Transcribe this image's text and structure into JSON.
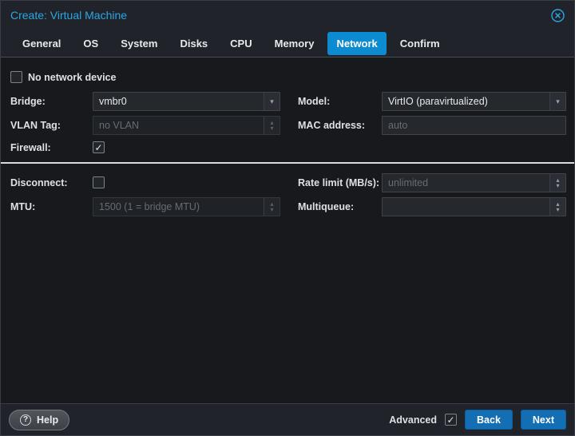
{
  "window": {
    "title": "Create: Virtual Machine"
  },
  "tabs": [
    {
      "label": "General",
      "active": false
    },
    {
      "label": "OS",
      "active": false
    },
    {
      "label": "System",
      "active": false
    },
    {
      "label": "Disks",
      "active": false
    },
    {
      "label": "CPU",
      "active": false
    },
    {
      "label": "Memory",
      "active": false
    },
    {
      "label": "Network",
      "active": true
    },
    {
      "label": "Confirm",
      "active": false
    }
  ],
  "form": {
    "no_network_device": {
      "label": "No network device",
      "checked": false
    },
    "bridge": {
      "label": "Bridge:",
      "value": "vmbr0",
      "type": "combo"
    },
    "vlan": {
      "label": "VLAN Tag:",
      "placeholder": "no VLAN",
      "type": "number",
      "disabled": true
    },
    "firewall": {
      "label": "Firewall:",
      "checked": true
    },
    "model": {
      "label": "Model:",
      "value": "VirtIO (paravirtualized)",
      "type": "combo"
    },
    "mac": {
      "label": "MAC address:",
      "placeholder": "auto",
      "type": "text"
    },
    "disconnect": {
      "label": "Disconnect:",
      "checked": false
    },
    "mtu": {
      "label": "MTU:",
      "placeholder": "1500 (1 = bridge MTU)",
      "type": "number",
      "disabled": true
    },
    "rate_limit": {
      "label": "Rate limit (MB/s):",
      "placeholder": "unlimited",
      "type": "number"
    },
    "multiqueue": {
      "label": "Multiqueue:",
      "placeholder": "",
      "type": "number"
    }
  },
  "footer": {
    "help_label": "Help",
    "help_icon_glyph": "?",
    "advanced_label": "Advanced",
    "advanced_checked": true,
    "back_label": "Back",
    "next_label": "Next"
  },
  "icons": {
    "close": "circle-x-icon",
    "combo_chevron": "chevron-down-icon",
    "spinner": "up-down-arrows-icon"
  },
  "colors": {
    "title_text": "#2ba7e4",
    "active_tab": "#0d8bd1",
    "button_blue": "#146eb4",
    "body_bg": "#17191d",
    "header_bg": "#20242a",
    "field_bg": "#25282d",
    "placeholder_text": "#686d73",
    "divider": "#d9dcdf"
  }
}
